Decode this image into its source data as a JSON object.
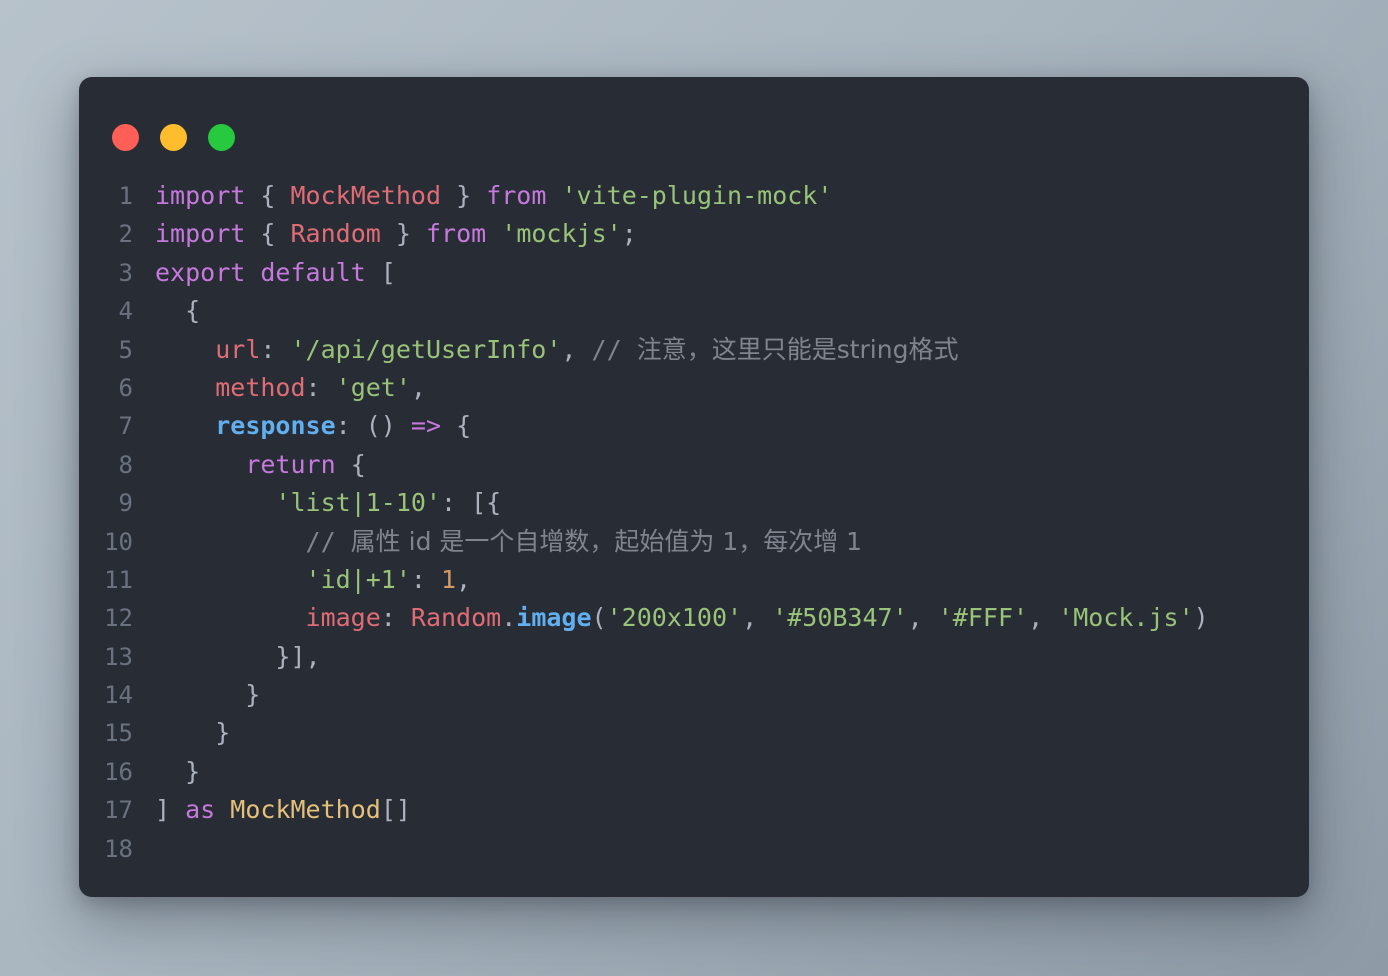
{
  "window": {
    "name": "code-snippet-card",
    "background_color": "#282c35",
    "page_background": "#b7c2cb",
    "traffic_lights": [
      {
        "name": "close",
        "color": "#ff5f56"
      },
      {
        "name": "minimize",
        "color": "#ffbd2e"
      },
      {
        "name": "maximize",
        "color": "#27c93f"
      }
    ]
  },
  "editor": {
    "language": "typescript",
    "line_numbers": [
      "1",
      "2",
      "3",
      "4",
      "5",
      "6",
      "7",
      "8",
      "9",
      "10",
      "11",
      "12",
      "13",
      "14",
      "15",
      "16",
      "17",
      "18"
    ],
    "lines": [
      {
        "number": "1",
        "tokens": [
          {
            "t": "import",
            "c": "keyword"
          },
          {
            "t": " ",
            "c": "plain"
          },
          {
            "t": "{",
            "c": "punct"
          },
          {
            "t": " ",
            "c": "plain"
          },
          {
            "t": "MockMethod",
            "c": "class"
          },
          {
            "t": " ",
            "c": "plain"
          },
          {
            "t": "}",
            "c": "punct"
          },
          {
            "t": " ",
            "c": "plain"
          },
          {
            "t": "from",
            "c": "keyword"
          },
          {
            "t": " ",
            "c": "plain"
          },
          {
            "t": "'vite-plugin-mock'",
            "c": "string"
          }
        ]
      },
      {
        "number": "2",
        "tokens": [
          {
            "t": "import",
            "c": "keyword"
          },
          {
            "t": " ",
            "c": "plain"
          },
          {
            "t": "{",
            "c": "punct"
          },
          {
            "t": " ",
            "c": "plain"
          },
          {
            "t": "Random",
            "c": "class"
          },
          {
            "t": " ",
            "c": "plain"
          },
          {
            "t": "}",
            "c": "punct"
          },
          {
            "t": " ",
            "c": "plain"
          },
          {
            "t": "from",
            "c": "keyword"
          },
          {
            "t": " ",
            "c": "plain"
          },
          {
            "t": "'mockjs'",
            "c": "string"
          },
          {
            "t": ";",
            "c": "punct"
          }
        ]
      },
      {
        "number": "3",
        "tokens": [
          {
            "t": "export",
            "c": "keyword"
          },
          {
            "t": " ",
            "c": "plain"
          },
          {
            "t": "default",
            "c": "keyword"
          },
          {
            "t": " ",
            "c": "plain"
          },
          {
            "t": "[",
            "c": "punct"
          }
        ]
      },
      {
        "number": "4",
        "tokens": [
          {
            "t": "  {",
            "c": "punct"
          }
        ]
      },
      {
        "number": "5",
        "tokens": [
          {
            "t": "    ",
            "c": "plain"
          },
          {
            "t": "url",
            "c": "prop"
          },
          {
            "t": ": ",
            "c": "punct"
          },
          {
            "t": "'/api/getUserInfo'",
            "c": "string"
          },
          {
            "t": ", ",
            "c": "punct"
          },
          {
            "t": "// ",
            "c": "comment"
          },
          {
            "t": "注意，这里只能是string格式",
            "c": "comment-cjk"
          }
        ]
      },
      {
        "number": "6",
        "tokens": [
          {
            "t": "    ",
            "c": "plain"
          },
          {
            "t": "method",
            "c": "prop"
          },
          {
            "t": ": ",
            "c": "punct"
          },
          {
            "t": "'get'",
            "c": "string"
          },
          {
            "t": ",",
            "c": "punct"
          }
        ]
      },
      {
        "number": "7",
        "tokens": [
          {
            "t": "    ",
            "c": "plain"
          },
          {
            "t": "response",
            "c": "func"
          },
          {
            "t": ": ",
            "c": "punct"
          },
          {
            "t": "()",
            "c": "punct"
          },
          {
            "t": " ",
            "c": "plain"
          },
          {
            "t": "=>",
            "c": "keyword"
          },
          {
            "t": " ",
            "c": "plain"
          },
          {
            "t": "{",
            "c": "punct"
          }
        ]
      },
      {
        "number": "8",
        "tokens": [
          {
            "t": "      ",
            "c": "plain"
          },
          {
            "t": "return",
            "c": "keyword"
          },
          {
            "t": " ",
            "c": "plain"
          },
          {
            "t": "{",
            "c": "punct"
          }
        ]
      },
      {
        "number": "9",
        "tokens": [
          {
            "t": "        ",
            "c": "plain"
          },
          {
            "t": "'list|1-10'",
            "c": "string"
          },
          {
            "t": ": ",
            "c": "punct"
          },
          {
            "t": "[{",
            "c": "punct"
          }
        ]
      },
      {
        "number": "10",
        "tokens": [
          {
            "t": "          ",
            "c": "plain"
          },
          {
            "t": "// ",
            "c": "comment"
          },
          {
            "t": "属性 id 是一个自增数，起始值为 1，每次增 1",
            "c": "comment-cjk"
          }
        ]
      },
      {
        "number": "11",
        "tokens": [
          {
            "t": "          ",
            "c": "plain"
          },
          {
            "t": "'id|+1'",
            "c": "string"
          },
          {
            "t": ": ",
            "c": "punct"
          },
          {
            "t": "1",
            "c": "number"
          },
          {
            "t": ",",
            "c": "punct"
          }
        ]
      },
      {
        "number": "12",
        "tokens": [
          {
            "t": "          ",
            "c": "plain"
          },
          {
            "t": "image",
            "c": "prop"
          },
          {
            "t": ": ",
            "c": "punct"
          },
          {
            "t": "Random",
            "c": "class"
          },
          {
            "t": ".",
            "c": "punct"
          },
          {
            "t": "image",
            "c": "method"
          },
          {
            "t": "(",
            "c": "punct"
          },
          {
            "t": "'200x100'",
            "c": "string"
          },
          {
            "t": ", ",
            "c": "punct"
          },
          {
            "t": "'#50B347'",
            "c": "string"
          },
          {
            "t": ", ",
            "c": "punct"
          },
          {
            "t": "'#FFF'",
            "c": "string"
          },
          {
            "t": ", ",
            "c": "punct"
          },
          {
            "t": "'Mock.js'",
            "c": "string"
          },
          {
            "t": ")",
            "c": "punct"
          }
        ]
      },
      {
        "number": "13",
        "tokens": [
          {
            "t": "        }],",
            "c": "punct"
          }
        ]
      },
      {
        "number": "14",
        "tokens": [
          {
            "t": "      }",
            "c": "punct"
          }
        ]
      },
      {
        "number": "15",
        "tokens": [
          {
            "t": "    }",
            "c": "punct"
          }
        ]
      },
      {
        "number": "16",
        "tokens": [
          {
            "t": "  }",
            "c": "punct"
          }
        ]
      },
      {
        "number": "17",
        "tokens": [
          {
            "t": "]",
            "c": "punct"
          },
          {
            "t": " ",
            "c": "plain"
          },
          {
            "t": "as",
            "c": "keyword"
          },
          {
            "t": " ",
            "c": "plain"
          },
          {
            "t": "MockMethod",
            "c": "type"
          },
          {
            "t": "[]",
            "c": "punct"
          }
        ]
      },
      {
        "number": "18",
        "tokens": []
      }
    ]
  },
  "theme": {
    "keyword": "#c679dd",
    "string": "#98c379",
    "class": "#e06c75",
    "property": "#e06c75",
    "function": "#61afef",
    "number": "#d19a66",
    "comment": "#7f848e",
    "type": "#e5c07b",
    "punctuation": "#abb2bf",
    "line_number": "#6a7280"
  }
}
